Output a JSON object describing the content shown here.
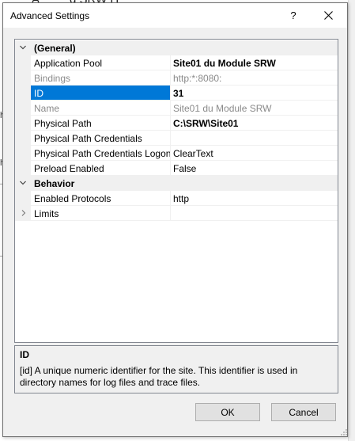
{
  "background": {
    "title_fragment": "...d... SRW H...",
    "edge_letters": [
      "h",
      "h"
    ],
    "scroll_arrow": "⌄"
  },
  "dialog": {
    "title": "Advanced Settings",
    "help_label": "?",
    "close_icon": "close-icon"
  },
  "grid": {
    "categories": [
      {
        "label": "(General)",
        "expanded": true
      },
      {
        "label": "Behavior",
        "expanded": true
      }
    ],
    "general_props": [
      {
        "name": "Application Pool",
        "value": "Site01 du Module SRW",
        "bold": true,
        "dim": false
      },
      {
        "name": "Bindings",
        "value": "http:*:8080:",
        "bold": false,
        "dim": true
      },
      {
        "name": "ID",
        "value": "31",
        "bold": true,
        "dim": false,
        "selected": true
      },
      {
        "name": "Name",
        "value": "Site01 du Module SRW",
        "bold": false,
        "dim": true
      },
      {
        "name": "Physical Path",
        "value": "C:\\SRW\\Site01",
        "bold": true,
        "dim": false
      },
      {
        "name": "Physical Path Credentials",
        "value": "",
        "bold": false,
        "dim": false
      },
      {
        "name": "Physical Path Credentials Logon",
        "value": "ClearText",
        "bold": false,
        "dim": false
      },
      {
        "name": "Preload Enabled",
        "value": "False",
        "bold": false,
        "dim": false
      }
    ],
    "behavior_props": [
      {
        "name": "Enabled Protocols",
        "value": "http",
        "expandable": false
      },
      {
        "name": "Limits",
        "value": "",
        "expandable": true,
        "expanded": false
      }
    ]
  },
  "description": {
    "title": "ID",
    "text": "[id] A unique numeric identifier for the site. This identifier is used in directory names for log files and trace files."
  },
  "buttons": {
    "ok": "OK",
    "cancel": "Cancel"
  },
  "colors": {
    "selection": "#0078d7",
    "category_bg": "#f0f0f0",
    "dim_text": "#8a8a8a"
  }
}
